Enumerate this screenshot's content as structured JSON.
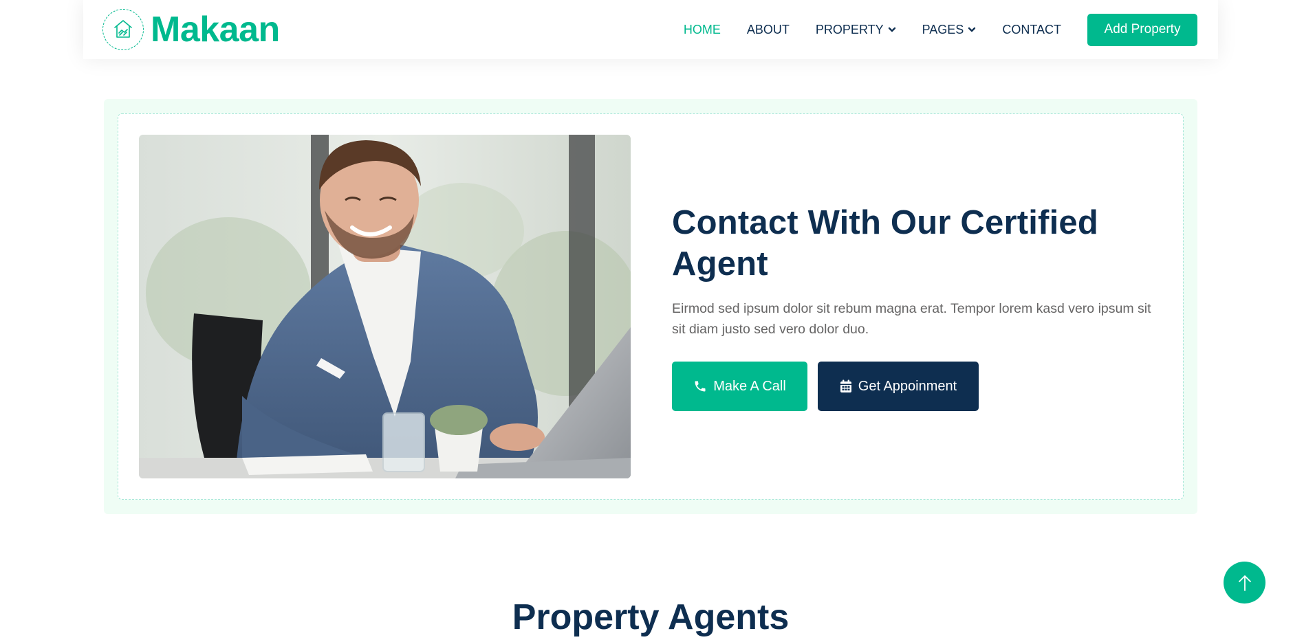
{
  "brand": {
    "name": "Makaan",
    "logo_icon": "house-handshake-icon"
  },
  "nav": {
    "items": [
      {
        "label": "HOME",
        "active": true
      },
      {
        "label": "ABOUT"
      },
      {
        "label": "PROPERTY",
        "dropdown": true
      },
      {
        "label": "PAGES",
        "dropdown": true
      },
      {
        "label": "CONTACT"
      }
    ],
    "cta_label": "Add Property"
  },
  "contact": {
    "title": "Contact With Our Certified Agent",
    "description": "Eirmod sed ipsum dolor sit rebum magna erat. Tempor lorem kasd vero ipsum sit sit diam justo sed vero dolor duo.",
    "call_label": "Make A Call",
    "call_icon": "phone-icon",
    "appointment_label": "Get Appoinment",
    "appointment_icon": "calendar-icon",
    "photo_alt": "agent-photo"
  },
  "agents": {
    "title": "Property Agents"
  },
  "back_to_top_icon": "arrow-up-icon",
  "colors": {
    "primary": "#00b98e",
    "dark": "#0e2e50",
    "light_bg": "#effdf5"
  }
}
